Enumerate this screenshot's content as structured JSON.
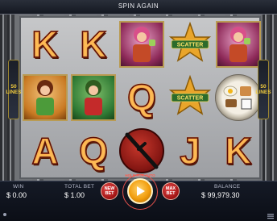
{
  "banner": {
    "title": "SPIN AGAIN"
  },
  "lines": {
    "left_label": "50 LINES",
    "right_label": "50 LINES",
    "left_count": "50",
    "left_word": "LINES",
    "right_count": "50",
    "right_word": "LINES"
  },
  "reels": {
    "r1": [
      {
        "type": "letter",
        "value": "K"
      },
      {
        "type": "portrait-orange"
      },
      {
        "type": "letter",
        "value": "A"
      }
    ],
    "r2": [
      {
        "type": "letter",
        "value": "K"
      },
      {
        "type": "portrait-green"
      },
      {
        "type": "letter",
        "value": "Q"
      }
    ],
    "r3": [
      {
        "type": "portrait-pink"
      },
      {
        "type": "letter",
        "value": "Q"
      },
      {
        "type": "baton-coin"
      }
    ],
    "r4": [
      {
        "type": "scatter",
        "value": "SCATTER"
      },
      {
        "type": "scatter",
        "value": "SCATTER"
      },
      {
        "type": "letter",
        "value": "J"
      }
    ],
    "r5": [
      {
        "type": "portrait-pink"
      },
      {
        "type": "food-plate"
      },
      {
        "type": "letter",
        "value": "K"
      }
    ]
  },
  "cells": {
    "r1c1": "K",
    "r2c1": "K",
    "r3c2": "Q",
    "r1c3": "A",
    "r2c3": "Q",
    "r4c3": "J",
    "r5c3": "K",
    "scatter1": "SCATTER",
    "scatter2": "SCATTER"
  },
  "bottom": {
    "win_label": "WIN",
    "win_value": "$ 0.00",
    "total_bet_label": "TOTAL BET",
    "total_bet_value": "$ 1.00",
    "new_bet": "NEW BET",
    "max_bet": "MAX BET",
    "hold_text": "HOLD FOR AUTO",
    "balance_label": "BALANCE",
    "balance_value": "$ 99,979.30"
  },
  "icons": {
    "spin": "play-icon",
    "menu": "menu-icon",
    "scatter": "sheriff-star-icon"
  },
  "colors": {
    "letter_red": "#e02a12",
    "bar_bg": "#0b0e16",
    "spin_orange": "#f19d0d",
    "btn_red": "#9f1313"
  }
}
